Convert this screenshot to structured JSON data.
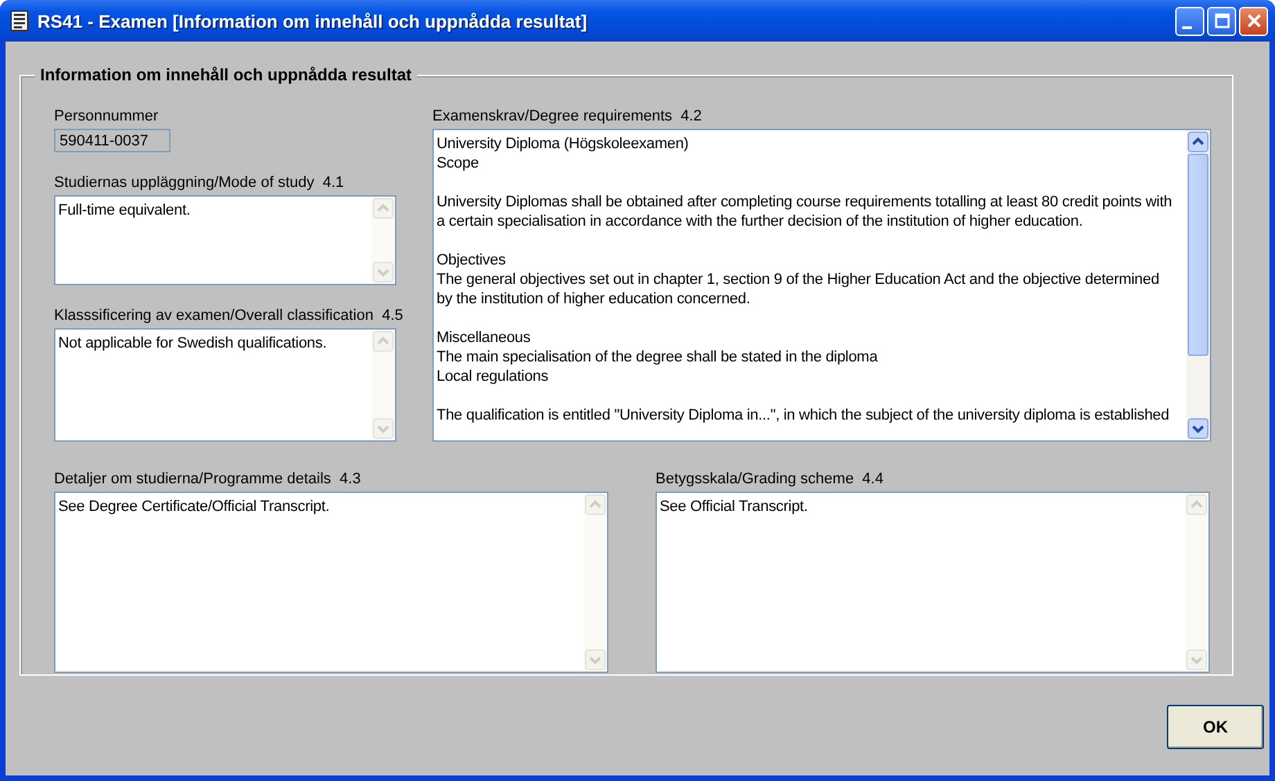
{
  "window": {
    "title": "RS41 - Examen [Information om innehåll och uppnådda resultat]"
  },
  "group": {
    "title": "Information om innehåll och uppnådda resultat"
  },
  "personnummer": {
    "label": "Personnummer",
    "value": "590411-0037"
  },
  "fields": [
    {
      "label": "Studiernas uppläggning/Mode of study  4.1",
      "text": "Full-time equivalent.",
      "scrollable": false
    },
    {
      "label": "Klasssificering av examen/Overall classification  4.5",
      "text": "Not applicable for Swedish qualifications.",
      "scrollable": false
    },
    {
      "label": "Examenskrav/Degree requirements  4.2",
      "text": "University Diploma (Högskoleexamen)\nScope\n\nUniversity Diplomas shall be obtained after completing course requirements totalling at least 80 credit points with\na certain specialisation in accordance with the further decision of the institution of higher education.\n\nObjectives\nThe general objectives set out in chapter 1, section 9 of the Higher Education Act and the objective determined\nby the institution of higher education concerned.\n\nMiscellaneous\nThe main specialisation of the degree shall be stated in the diploma\nLocal regulations\n\nThe qualification is entitled \"University Diploma in...\", in which the subject of the university diploma is established",
      "scrollable": true
    },
    {
      "label": "Detaljer om studierna/Programme details  4.3",
      "text": "See Degree Certificate/Official Transcript.",
      "scrollable": false
    },
    {
      "label": "Betygsskala/Grading scheme  4.4",
      "text": "See Official Transcript.",
      "scrollable": false
    }
  ],
  "buttons": [
    {
      "label": "OK"
    }
  ]
}
